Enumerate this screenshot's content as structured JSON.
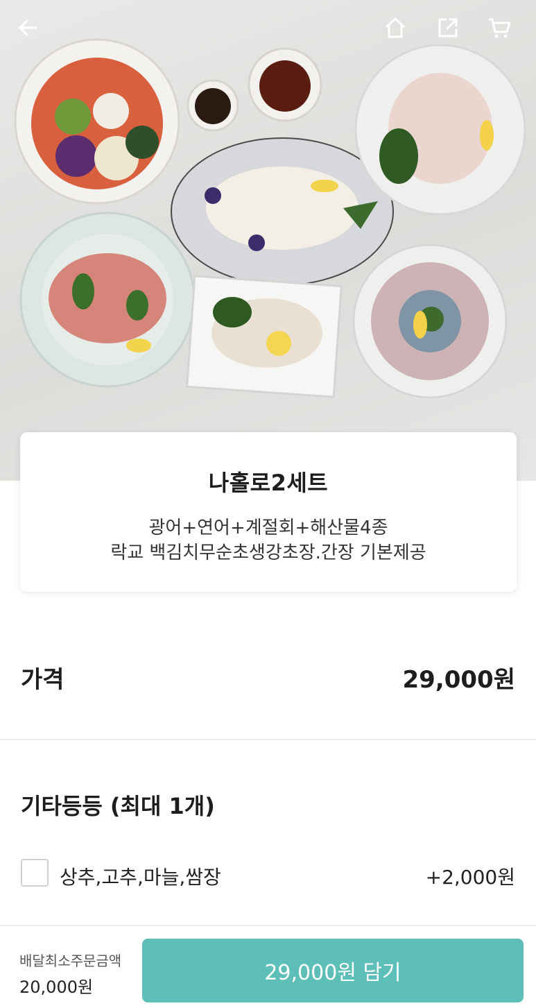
{
  "header": {
    "icons": [
      "back-arrow-icon",
      "home-icon",
      "share-icon",
      "cart-icon"
    ]
  },
  "product": {
    "name": "나홀로2세트",
    "description_line1": "광어+연어+계절회+해산물4종",
    "description_line2": "락교 백김치무순초생강초장.간장 기본제공"
  },
  "price": {
    "label": "가격",
    "value": "29,000원"
  },
  "options": {
    "group_title": "기타등등 (최대 1개)",
    "items": [
      {
        "label": "상추,고추,마늘,쌈장",
        "price": "+2,000원",
        "checked": false
      }
    ]
  },
  "footer": {
    "min_order_label": "배달최소주문금액",
    "min_order_value": "20,000원",
    "add_button_label": "29,000원 담기"
  },
  "colors": {
    "accent": "#5ebfb9",
    "text": "#1d1d1d",
    "divider": "#ececec"
  }
}
